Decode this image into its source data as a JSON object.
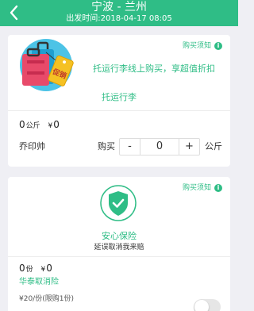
{
  "header": {
    "route": "宁波 - 兰州",
    "depart_time": "出发时间:2018-04-17 08:05",
    "bg_color": "#2fbd86"
  },
  "luggage_card": {
    "notice": "购买须知",
    "promo": "托运行李线上购买，享超值折扣",
    "product_name": "托运行李",
    "tag_text": "促销",
    "quantity": "0",
    "quantity_unit": "公斤",
    "price": "0",
    "currency": "¥",
    "provider": "乔印帅",
    "buy_label": "购买",
    "stepper": {
      "minus": "-",
      "value": "0",
      "plus": "+"
    },
    "unit_label": "公斤"
  },
  "insurance_card": {
    "notice": "购买须知",
    "title": "安心保险",
    "subtitle": "延误取消我来赔",
    "quantity": "0",
    "quantity_unit": "份",
    "price": "0",
    "currency": "¥",
    "provider": "华泰取消险",
    "price_note": "¥20/份(限购1份)",
    "toggle_on": false
  }
}
